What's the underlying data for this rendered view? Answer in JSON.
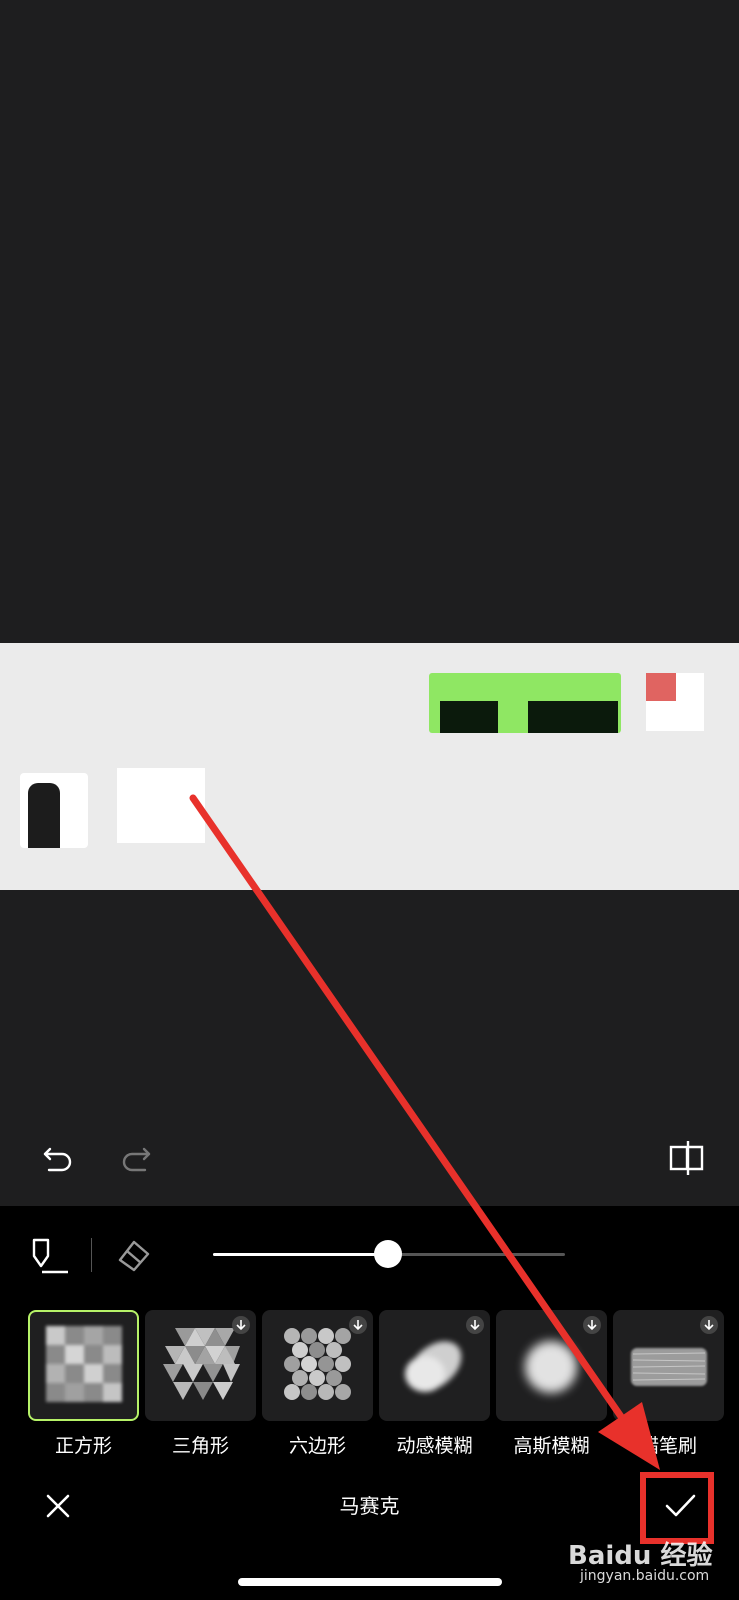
{
  "toolbar": {
    "undo_icon": "undo-icon",
    "redo_icon": "redo-icon",
    "compare_icon": "compare-icon"
  },
  "tools": {
    "brush_icon": "brush-tool-icon",
    "eraser_icon": "eraser-icon",
    "size_value": 0.5
  },
  "brushes": [
    {
      "label": "正方形",
      "selected": true,
      "downloadable": false
    },
    {
      "label": "三角形",
      "selected": false,
      "downloadable": true
    },
    {
      "label": "六边形",
      "selected": false,
      "downloadable": true
    },
    {
      "label": "动感模糊",
      "selected": false,
      "downloadable": true
    },
    {
      "label": "高斯模糊",
      "selected": false,
      "downloadable": true
    },
    {
      "label": "蜡笔刷",
      "selected": false,
      "downloadable": true
    }
  ],
  "footer": {
    "title": "马赛克",
    "cancel_icon": "close-icon",
    "confirm_icon": "check-icon"
  },
  "watermark": {
    "logo": "Baidu 经验",
    "url": "jingyan.baidu.com"
  },
  "colors": {
    "accent": "#b6f268",
    "annotation": "#e8312b"
  }
}
